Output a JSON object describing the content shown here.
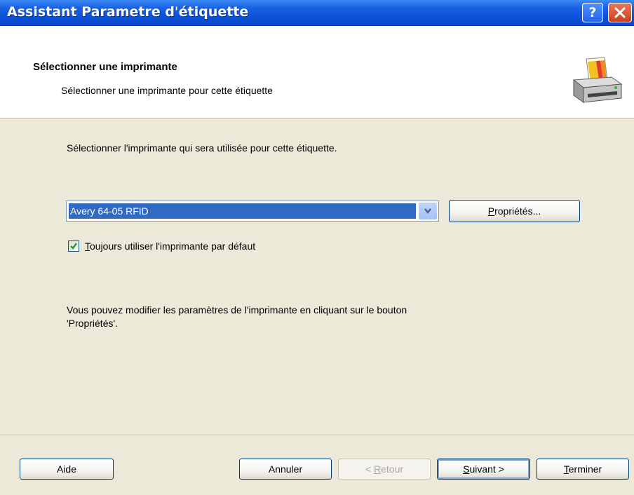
{
  "window": {
    "title": "Assistant  Parametre d'étiquette",
    "help_button": "?",
    "close_button": "✕"
  },
  "header": {
    "title": "Sélectionner une imprimante",
    "subtitle": "Sélectionner une imprimante pour cette étiquette",
    "icon": "printer-icon"
  },
  "body": {
    "intro": "Sélectionner l'imprimante qui sera utilisée pour cette étiquette.",
    "printer_select": {
      "value": "Avery 64-05 RFID"
    },
    "properties_button": {
      "mnemonic": "P",
      "rest": "ropriétés..."
    },
    "default_checkbox": {
      "checked": true,
      "mnemonic": "T",
      "rest": "oujours utiliser l'imprimante par défaut"
    },
    "note_line1": "Vous pouvez modifier les paramètres de l'imprimante en cliquant sur le bouton",
    "note_line2": "'Propriétés'."
  },
  "footer": {
    "aide": "Aide",
    "annuler": "Annuler",
    "retour": {
      "prefix": "< ",
      "mnemonic": "R",
      "rest": "etour",
      "enabled": false
    },
    "suivant": {
      "mnemonic": "S",
      "rest": "uivant >"
    },
    "terminer": {
      "mnemonic": "T",
      "rest": "erminer"
    }
  },
  "colors": {
    "titlebar": "#0a4fd6",
    "dialog_bg": "#ece9d8",
    "selection": "#316ac5"
  }
}
